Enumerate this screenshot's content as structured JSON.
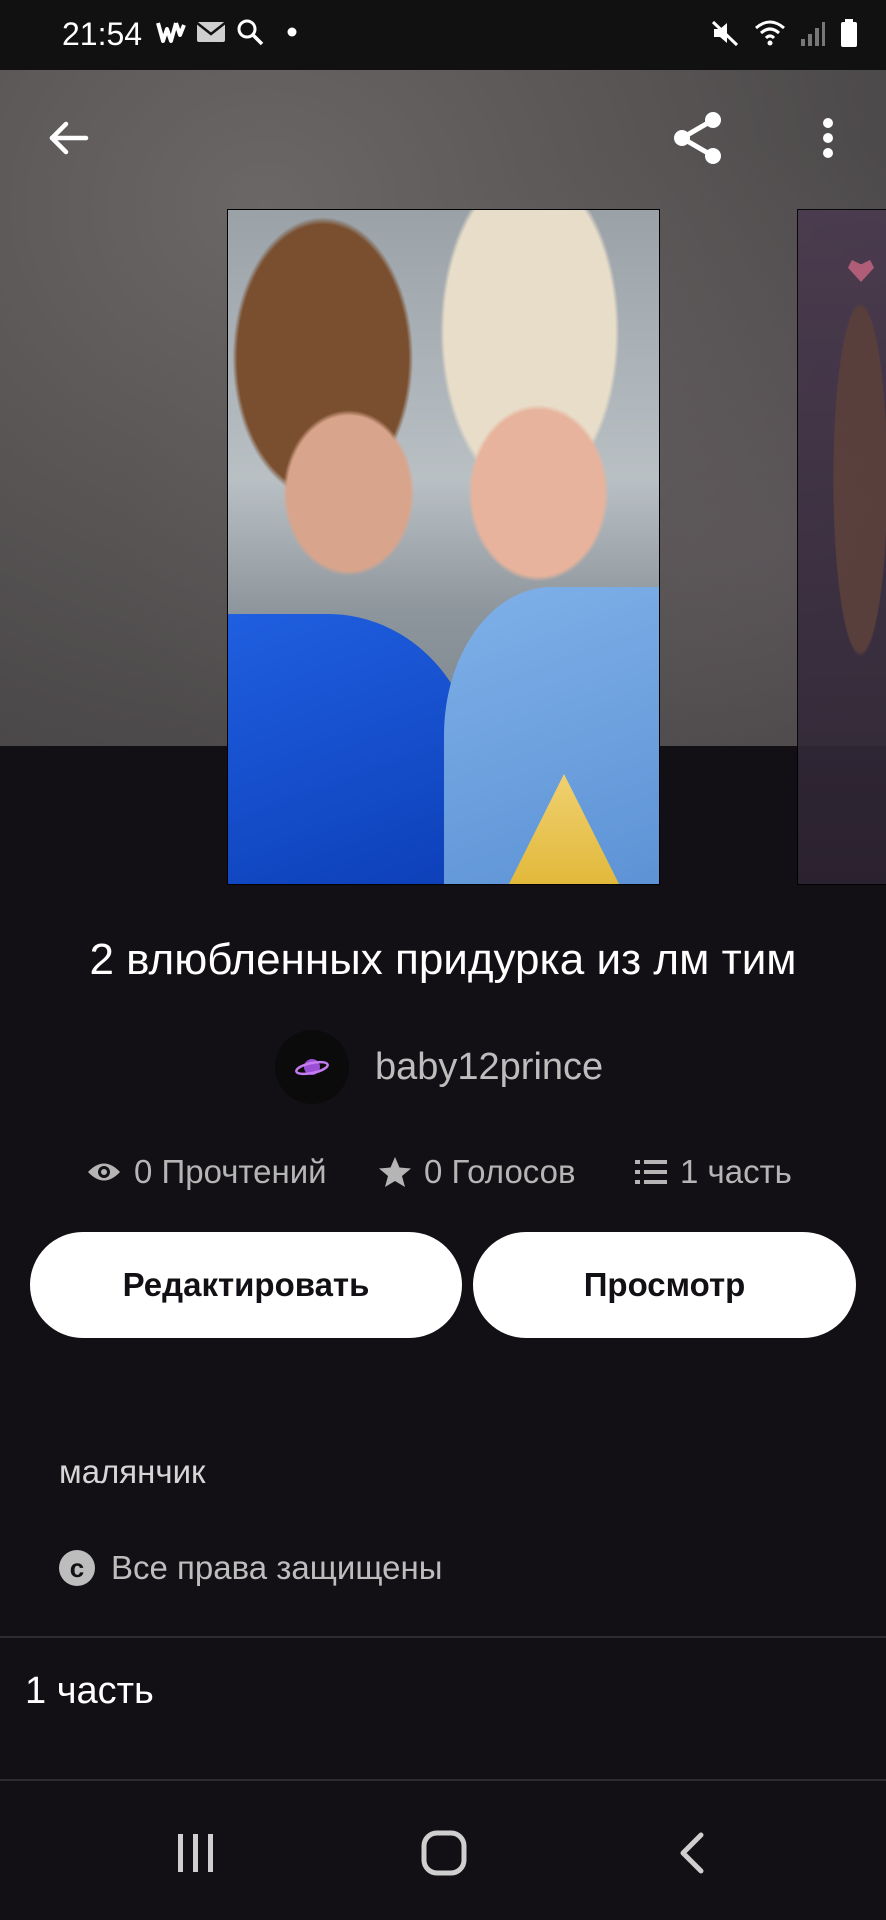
{
  "status_bar": {
    "time": "21:54",
    "app_icon": "wattpad-icon",
    "icons_left": [
      "mail-icon",
      "search-icon",
      "dot-icon"
    ],
    "icons_right": [
      "mute-icon",
      "wifi-icon",
      "signal-icon",
      "battery-icon"
    ]
  },
  "header": {
    "back_icon": "arrow-left-icon",
    "share_icon": "share-icon",
    "more_icon": "more-vert-icon"
  },
  "story": {
    "title": "2 влюбленных придурка из лм тим",
    "author": "baby12prince",
    "author_avatar_icon": "planet-icon"
  },
  "stats": {
    "reads": "0 Прочтений",
    "votes": "0 Голосов",
    "parts": "1 часть"
  },
  "actions": {
    "edit_label": "Редактировать",
    "view_label": "Просмотр"
  },
  "description": "малянчик",
  "copyright": "Все права защищены",
  "parts_list": [
    {
      "title": "1 часть"
    }
  ],
  "nav_bar": {
    "recents_icon": "recents-icon",
    "home_icon": "home-icon",
    "back_icon": "nav-back-icon"
  }
}
